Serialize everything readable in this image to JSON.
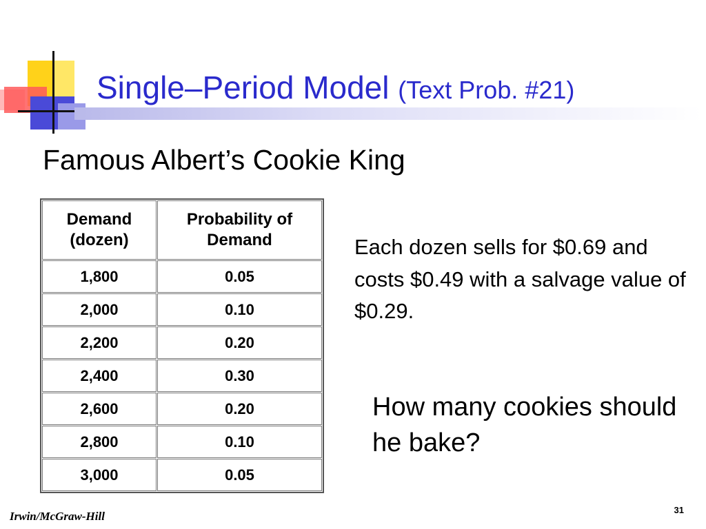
{
  "slide": {
    "title": "Single–Period Model",
    "title_suffix": "(Text Prob. #21)",
    "subtitle": "Famous Albert’s Cookie King",
    "table": {
      "headers": [
        "Demand (dozen)",
        "Probability of Demand"
      ],
      "rows": [
        [
          "1,800",
          "0.05"
        ],
        [
          "2,000",
          "0.10"
        ],
        [
          "2,200",
          "0.20"
        ],
        [
          "2,400",
          "0.30"
        ],
        [
          "2,600",
          "0.20"
        ],
        [
          "2,800",
          "0.10"
        ],
        [
          "3,000",
          "0.05"
        ]
      ]
    },
    "info": "Each dozen sells for $0.69 and costs $0.49 with a salvage value of $0.29.",
    "question": "How many cookies should he bake?",
    "footer": "Irwin/McGraw-Hill",
    "page_number": "31"
  }
}
